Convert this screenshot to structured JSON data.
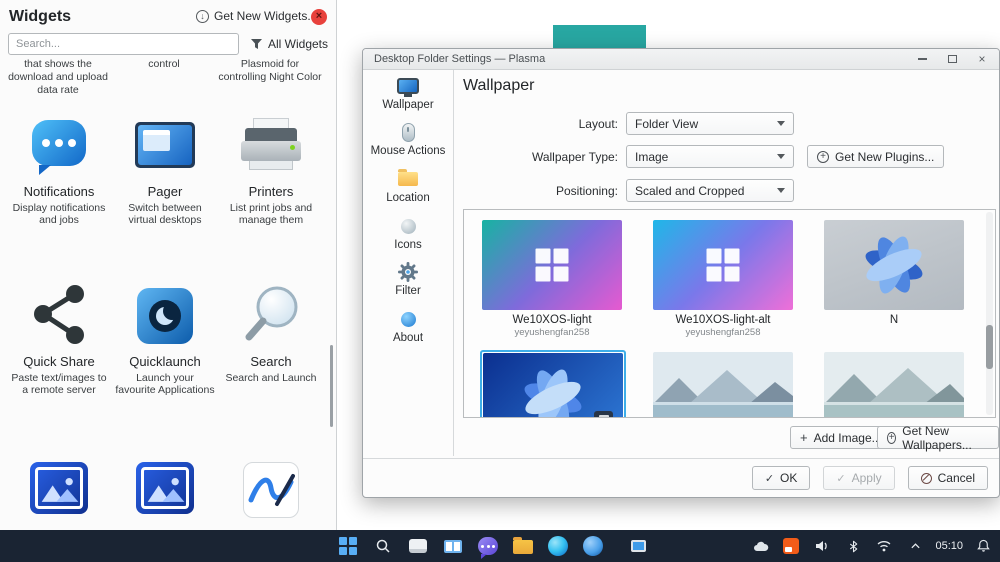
{
  "icons": {
    "check": "✓",
    "plus": "+",
    "down_arrow": "↓",
    "close_x": "×"
  },
  "desktop": {
    "accent_teal": "#28a7a2"
  },
  "widgets_panel": {
    "title": "Widgets",
    "get_new_widgets_label": "Get New Widgets...",
    "search_placeholder": "Search...",
    "filter_label": "All Widgets",
    "partial_descriptions": [
      "that shows the download and upload data rate",
      "control",
      "Plasmoid for controlling Night Color"
    ],
    "items": [
      {
        "name": "Notifications",
        "description": "Display notifications and jobs",
        "icon": "notifications-icon"
      },
      {
        "name": "Pager",
        "description": "Switch between virtual desktops",
        "icon": "pager-icon"
      },
      {
        "name": "Printers",
        "description": "List print jobs and manage them",
        "icon": "printers-icon"
      },
      {
        "name": "Quick Share",
        "description": "Paste text/images to a remote server",
        "icon": "share-icon"
      },
      {
        "name": "Quicklaunch",
        "description": "Launch your favourite Applications",
        "icon": "quicklaunch-icon"
      },
      {
        "name": "Search",
        "description": "Search and Launch",
        "icon": "search-widget-icon"
      }
    ]
  },
  "dialog": {
    "window_title": "Desktop Folder Settings — Plasma",
    "sidebar": [
      {
        "label": "Wallpaper",
        "icon": "wallpaper-icon"
      },
      {
        "label": "Mouse Actions",
        "icon": "mouse-icon"
      },
      {
        "label": "Location",
        "icon": "folder-icon"
      },
      {
        "label": "Icons",
        "icon": "icons-icon"
      },
      {
        "label": "Filter",
        "icon": "filter-icon"
      },
      {
        "label": "About",
        "icon": "about-icon"
      }
    ],
    "heading": "Wallpaper",
    "form": {
      "layout_label": "Layout:",
      "layout_value": "Folder View",
      "type_label": "Wallpaper Type:",
      "type_value": "Image",
      "positioning_label": "Positioning:",
      "positioning_value": "Scaled and Cropped"
    },
    "wallpapers": [
      {
        "title": "We10XOS-light",
        "author": "yeyushengfan258"
      },
      {
        "title": "We10XOS-light-alt",
        "author": "yeyushengfan258"
      },
      {
        "title": "N",
        "author": ""
      }
    ],
    "buttons": {
      "get_new_plugins": "Get New Plugins...",
      "add_image": "Add Image...",
      "get_new_wallpapers": "Get New Wallpapers...",
      "ok": "OK",
      "apply": "Apply",
      "cancel": "Cancel"
    }
  },
  "taskbar": {
    "time": "05:10"
  }
}
